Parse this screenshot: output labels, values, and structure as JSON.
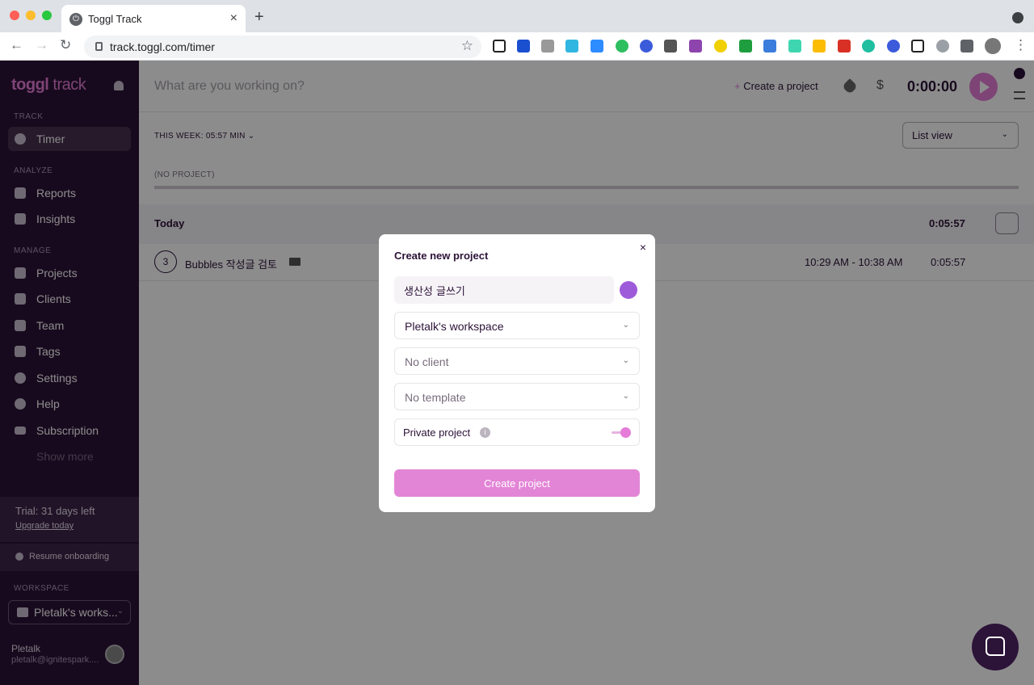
{
  "browser": {
    "tab_title": "Toggl Track",
    "url": "track.toggl.com/timer",
    "tab_close": "×",
    "new_tab": "+"
  },
  "sidebar": {
    "logo_bold": "toggl",
    "logo_thin": " track",
    "sections": {
      "track": "TRACK",
      "analyze": "ANALYZE",
      "manage": "MANAGE",
      "workspace": "WORKSPACE"
    },
    "items": [
      {
        "label": "Timer",
        "icon": "clock-icon"
      },
      {
        "label": "Reports",
        "icon": "reports-icon"
      },
      {
        "label": "Insights",
        "icon": "insights-icon"
      },
      {
        "label": "Projects",
        "icon": "folder-icon"
      },
      {
        "label": "Clients",
        "icon": "client-icon"
      },
      {
        "label": "Team",
        "icon": "team-icon"
      },
      {
        "label": "Tags",
        "icon": "tag-icon"
      },
      {
        "label": "Settings",
        "icon": "gear-icon"
      },
      {
        "label": "Help",
        "icon": "help-icon"
      },
      {
        "label": "Subscription",
        "icon": "card-icon"
      },
      {
        "label": "Show more",
        "icon": "chevron-down-icon"
      }
    ],
    "trial_text": "Trial: 31 days left",
    "upgrade_link": "Upgrade today",
    "onboarding": "Resume onboarding",
    "workspace_name": "Pletalk's works...",
    "user_name": "Pletalk",
    "user_email": "pletalk@ignitespark...."
  },
  "timer_bar": {
    "placeholder": "What are you working on?",
    "create_project": "Create a project",
    "duration": "0:00:00",
    "dollar": "$"
  },
  "content": {
    "week_summary": "THIS WEEK: 05:57 MIN",
    "view_select": "List view",
    "no_project": "(NO PROJECT)",
    "day_label": "Today",
    "day_total": "0:05:57",
    "entry": {
      "count": "3",
      "description": "Bubbles 작성글 검토",
      "time_range": "10:29 AM - 10:38 AM",
      "duration": "0:05:57"
    }
  },
  "modal": {
    "title": "Create new project",
    "close": "×",
    "project_name": "생산성 글쓰기",
    "workspace": "Pletalk's workspace",
    "client": "No client",
    "template": "No template",
    "private_label": "Private project",
    "private_enabled": true,
    "submit": "Create project"
  },
  "colors": {
    "accent": "#e57cd8",
    "sidebar_bg": "#2c1338",
    "project_color": "#9e5bd9",
    "submit_bg": "#e385d6"
  }
}
